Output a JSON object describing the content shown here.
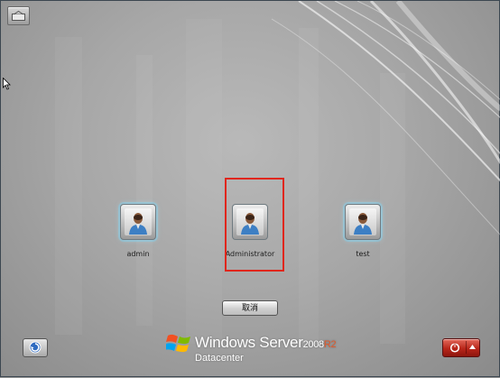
{
  "users": [
    {
      "name": "admin"
    },
    {
      "name": "Administrator"
    },
    {
      "name": "test"
    }
  ],
  "selected_user": "Administrator",
  "cancel_label": "取消",
  "branding": {
    "product": "Windows Server",
    "version": "2008",
    "release": "R2",
    "edition": "Datacenter"
  },
  "colors": {
    "selection_border": "#e0261c",
    "power_button": "#b8261a",
    "release_text": "#e05a2c"
  },
  "icons": {
    "top_left": "switch-display-icon",
    "bottom_left": "ease-of-access-icon",
    "bottom_right": "power-icon"
  }
}
